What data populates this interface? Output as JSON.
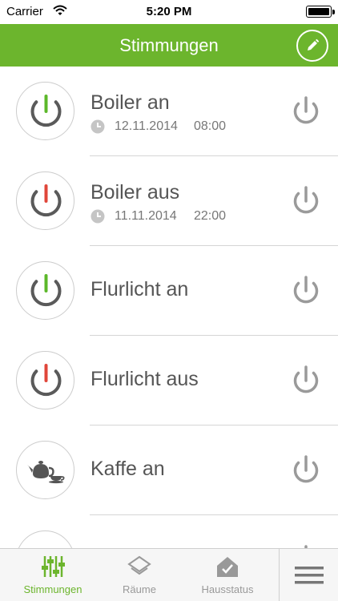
{
  "status_bar": {
    "carrier": "Carrier",
    "time": "5:20 PM"
  },
  "header": {
    "title": "Stimmungen"
  },
  "scenes": [
    {
      "title": "Boiler an",
      "date": "12.11.2014",
      "time": "08:00",
      "icon": "power-on-icon",
      "accent": "#5cb82a"
    },
    {
      "title": "Boiler aus",
      "date": "11.11.2014",
      "time": "22:00",
      "icon": "power-off-icon",
      "accent": "#e0463a"
    },
    {
      "title": "Flurlicht an",
      "icon": "power-on-icon",
      "accent": "#5cb82a"
    },
    {
      "title": "Flurlicht aus",
      "icon": "power-off-icon",
      "accent": "#e0463a"
    },
    {
      "title": "Kaffe an",
      "icon": "teapot-icon"
    }
  ],
  "tabs": [
    {
      "label": "Stimmungen",
      "icon": "sliders-icon",
      "active": true
    },
    {
      "label": "Räume",
      "icon": "layers-icon",
      "active": false
    },
    {
      "label": "Hausstatus",
      "icon": "house-check-icon",
      "active": false
    }
  ],
  "colors": {
    "brand_green": "#6cb52d",
    "tab_inactive": "#999999"
  }
}
